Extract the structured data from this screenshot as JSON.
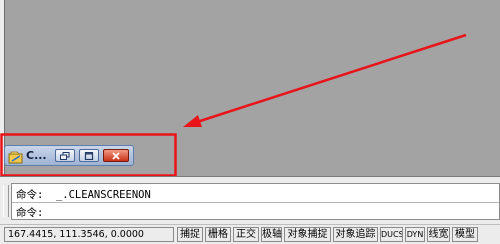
{
  "window": {
    "title": "C...",
    "buttons": {
      "restore": "restore",
      "maximize": "maximize",
      "close": "close"
    }
  },
  "command": {
    "line1": "命令:  _.CLEANSCREENON",
    "line2": "命令:"
  },
  "status": {
    "coordinates": "167.4415, 111.3546, 0.0000",
    "toggles": [
      "捕捉",
      "栅格",
      "正交",
      "极轴",
      "对象捕捉",
      "对象追踪",
      "DUCS",
      "DYN",
      "线宽",
      "模型"
    ]
  },
  "annotation": {
    "color": "#e8141a"
  },
  "icons": [
    "app-icon",
    "restore-icon",
    "maximize-icon",
    "close-icon"
  ]
}
